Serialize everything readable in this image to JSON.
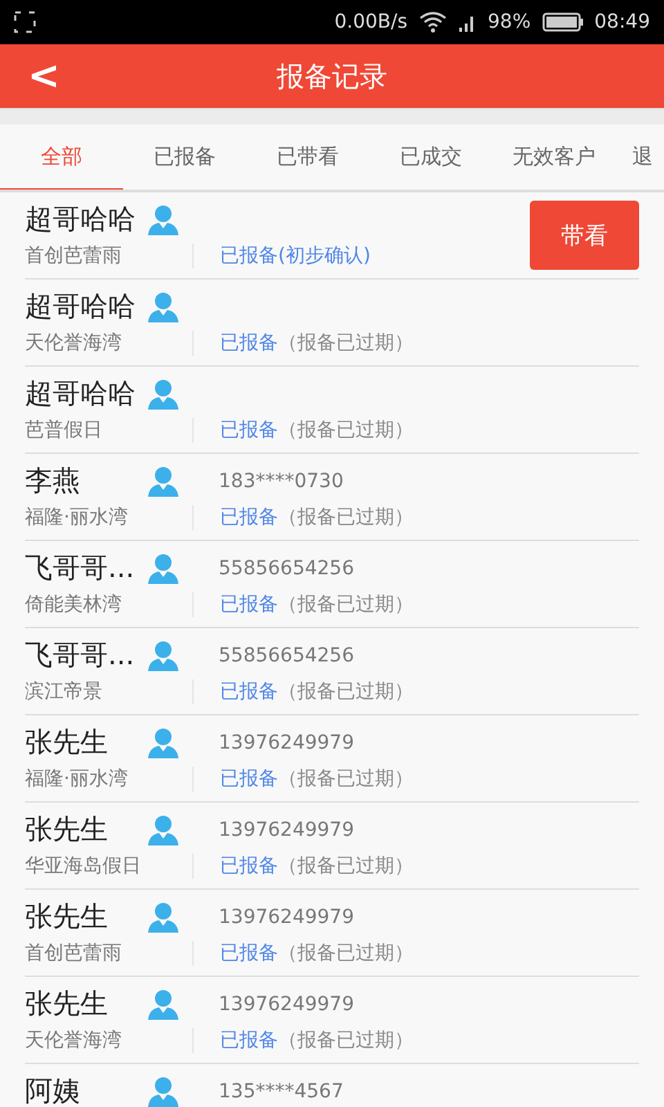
{
  "status_bar": {
    "speed": "0.00B/s",
    "battery": "98%",
    "time": "08:49"
  },
  "header": {
    "back": "<",
    "title": "报备记录"
  },
  "tabs": [
    {
      "label": "全部",
      "selected": true
    },
    {
      "label": "已报备",
      "selected": false
    },
    {
      "label": "已带看",
      "selected": false
    },
    {
      "label": "已成交",
      "selected": false
    },
    {
      "label": "无效客户",
      "selected": false
    },
    {
      "label": "退",
      "selected": false
    }
  ],
  "records": [
    {
      "name": "超哥哈哈",
      "project": "首创芭蕾雨",
      "status": "已报备(初步确认)",
      "action": "带看"
    },
    {
      "name": "超哥哈哈",
      "project": "天伦誉海湾",
      "status": "已报备",
      "note": "（报备已过期）"
    },
    {
      "name": "超哥哈哈",
      "project": "芭普假日",
      "status": "已报备",
      "note": "（报备已过期）"
    },
    {
      "name": "李燕",
      "phone": "183****0730",
      "project": "福隆·丽水湾",
      "status": "已报备",
      "note": "（报备已过期）"
    },
    {
      "name": "飞哥哥...",
      "phone": "55856654256",
      "project": "倚能美林湾",
      "status": "已报备",
      "note": "（报备已过期）"
    },
    {
      "name": "飞哥哥...",
      "phone": "55856654256",
      "project": "滨江帝景",
      "status": "已报备",
      "note": "（报备已过期）"
    },
    {
      "name": "张先生",
      "phone": "13976249979",
      "project": "福隆·丽水湾",
      "status": "已报备",
      "note": "（报备已过期）"
    },
    {
      "name": "张先生",
      "phone": "13976249979",
      "project": "华亚海岛假日",
      "status": "已报备",
      "note": "（报备已过期）"
    },
    {
      "name": "张先生",
      "phone": "13976249979",
      "project": "首创芭蕾雨",
      "status": "已报备",
      "note": "（报备已过期）"
    },
    {
      "name": "张先生",
      "phone": "13976249979",
      "project": "天伦誉海湾",
      "status": "已报备",
      "note": "（报备已过期）"
    },
    {
      "name": "阿姨",
      "phone": "135****4567"
    }
  ]
}
